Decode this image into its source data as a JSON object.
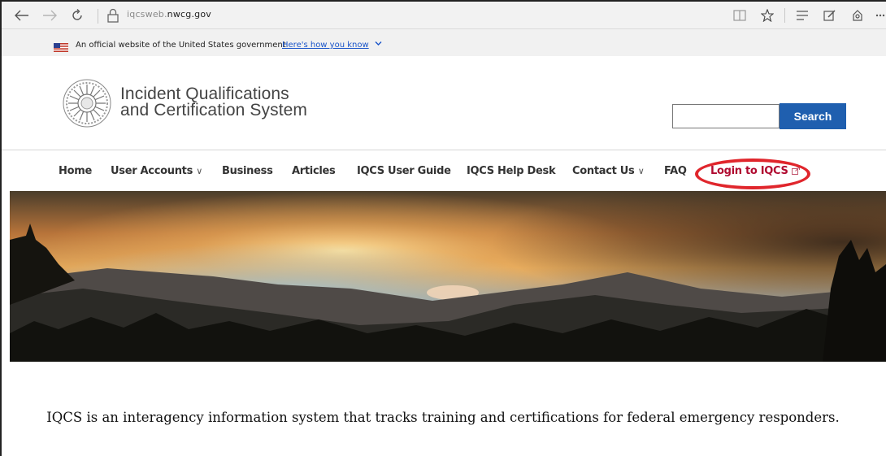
{
  "browser": {
    "url_prefix": "iqcsweb.",
    "url_host": "nwcg.gov",
    "icons": [
      "back-icon",
      "forward-icon",
      "refresh-icon",
      "lock-icon",
      "reading-view-icon",
      "favorite-star-icon",
      "hub-icon",
      "web-note-icon",
      "share-icon",
      "more-icon"
    ]
  },
  "gov_banner": {
    "text": "An official website of the United States government",
    "link": "Here's how you know"
  },
  "header": {
    "title_line1": "Incident Qualifications",
    "title_line2": "and Certification System",
    "search_placeholder": "",
    "search_button": "Search"
  },
  "nav": {
    "items": [
      {
        "label": "Home",
        "dropdown": false
      },
      {
        "label": "User Accounts",
        "dropdown": true
      },
      {
        "label": "Business",
        "dropdown": false
      },
      {
        "label": "Articles",
        "dropdown": false
      },
      {
        "label": "IQCS User Guide",
        "dropdown": false
      },
      {
        "label": "IQCS Help Desk",
        "dropdown": false
      },
      {
        "label": "Contact Us",
        "dropdown": true
      },
      {
        "label": "FAQ",
        "dropdown": false
      },
      {
        "label": "Login to IQCS",
        "dropdown": false,
        "external": true
      }
    ],
    "chevron": "∨",
    "highlighted_item": "Login to IQCS"
  },
  "intro": {
    "text": "IQCS is an interagency information system that tracks training and certifications for federal emergency responders."
  },
  "colors": {
    "accent_blue": "#1f5faf",
    "login_red": "#b00a30",
    "highlight_red": "#e0262c",
    "link_blue": "#1a55c9"
  }
}
